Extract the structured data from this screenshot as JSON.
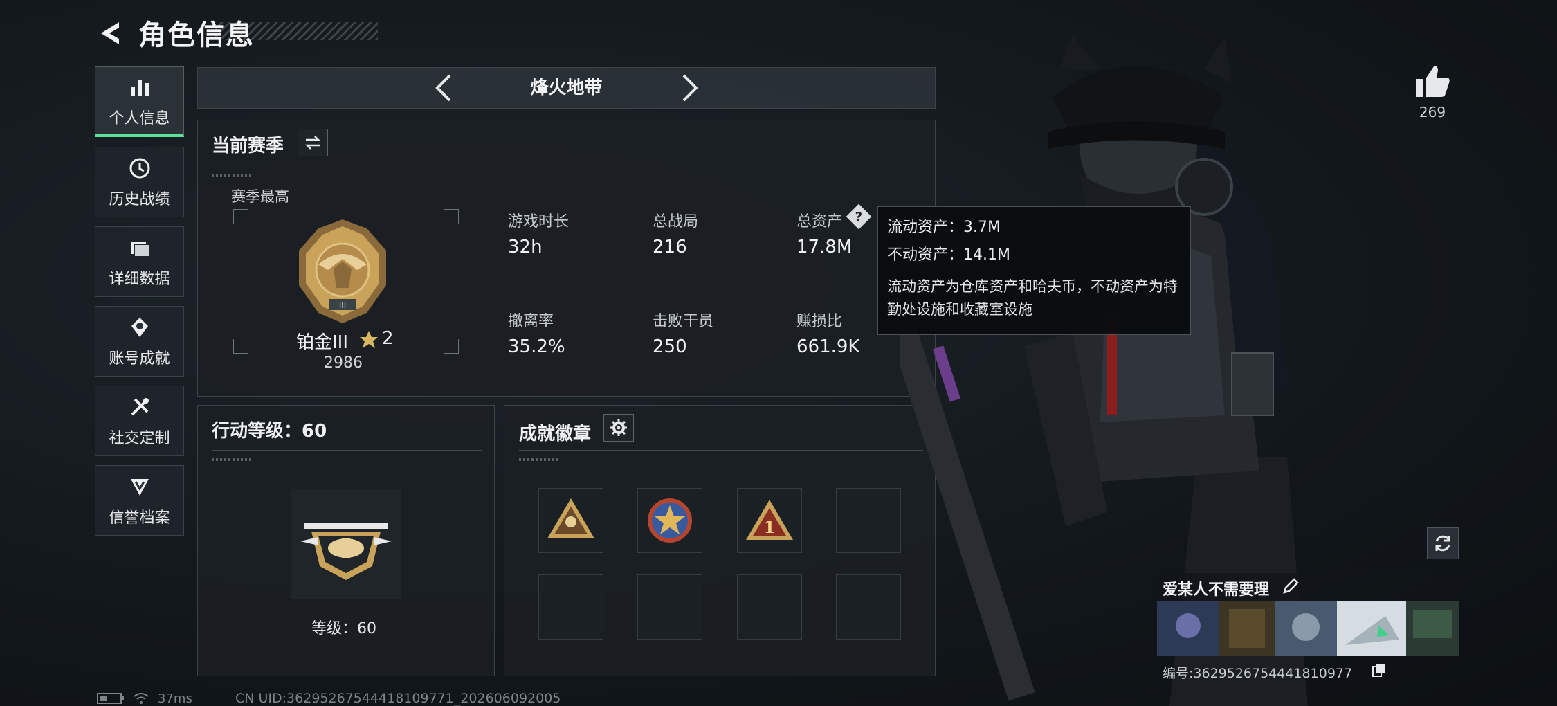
{
  "header": {
    "title": "角色信息"
  },
  "sidebar": {
    "items": [
      {
        "label": "个人信息",
        "icon": "bar-chart-icon",
        "active": true
      },
      {
        "label": "历史战绩",
        "icon": "history-clock-icon"
      },
      {
        "label": "详细数据",
        "icon": "folder-icon"
      },
      {
        "label": "账号成就",
        "icon": "achievement-icon"
      },
      {
        "label": "社交定制",
        "icon": "tools-icon"
      },
      {
        "label": "信誉档案",
        "icon": "shield-rank-icon"
      }
    ]
  },
  "mode": {
    "title": "烽火地带"
  },
  "season": {
    "title": "当前赛季",
    "best_label": "赛季最高",
    "rank_name": "铂金III",
    "rank_stars": "2",
    "rank_points": "2986",
    "stats": [
      {
        "label": "游戏时长",
        "value": "32h"
      },
      {
        "label": "总战局",
        "value": "216"
      },
      {
        "label": "总资产",
        "value": "17.8M"
      },
      {
        "label": "撤离率",
        "value": "35.2%"
      },
      {
        "label": "击败干员",
        "value": "250"
      },
      {
        "label": "赚损比",
        "value": "661.9K"
      }
    ]
  },
  "tooltip": {
    "liquid": "流动资产：3.7M",
    "fixed": "不动资产：14.1M",
    "desc": "流动资产为仓库资产和哈夫币，不动资产为特勤处设施和收藏室设施"
  },
  "action_level": {
    "title": "行动等级：60",
    "level_text": "等级：60"
  },
  "badges": {
    "title": "成就徽章"
  },
  "profile": {
    "likes": "269",
    "name": "爱某人不需要理",
    "id_text": "编号:3629526754441810977"
  },
  "status": {
    "ping": "37ms",
    "uid": "CN UID:36295267544418109771_202606092005"
  },
  "colors": {
    "accent_green": "#5fe09a",
    "gold": "#c9a35a"
  }
}
